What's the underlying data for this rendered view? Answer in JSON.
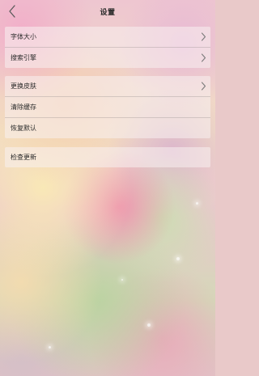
{
  "nav": {
    "title": "设置",
    "back_icon": "chevron-left-icon"
  },
  "groups": [
    {
      "items": [
        {
          "label": "字体大小",
          "has_chevron": true
        },
        {
          "label": "搜索引擎",
          "has_chevron": true
        }
      ]
    },
    {
      "items": [
        {
          "label": "更换皮肤",
          "has_chevron": true
        },
        {
          "label": "清除缓存",
          "has_chevron": false
        },
        {
          "label": "恢复默认",
          "has_chevron": false
        }
      ]
    },
    {
      "items": [
        {
          "label": "检查更新",
          "has_chevron": false
        }
      ]
    }
  ],
  "colors": {
    "text": "#2a2a2a",
    "chevron": "#7a7a7a"
  }
}
